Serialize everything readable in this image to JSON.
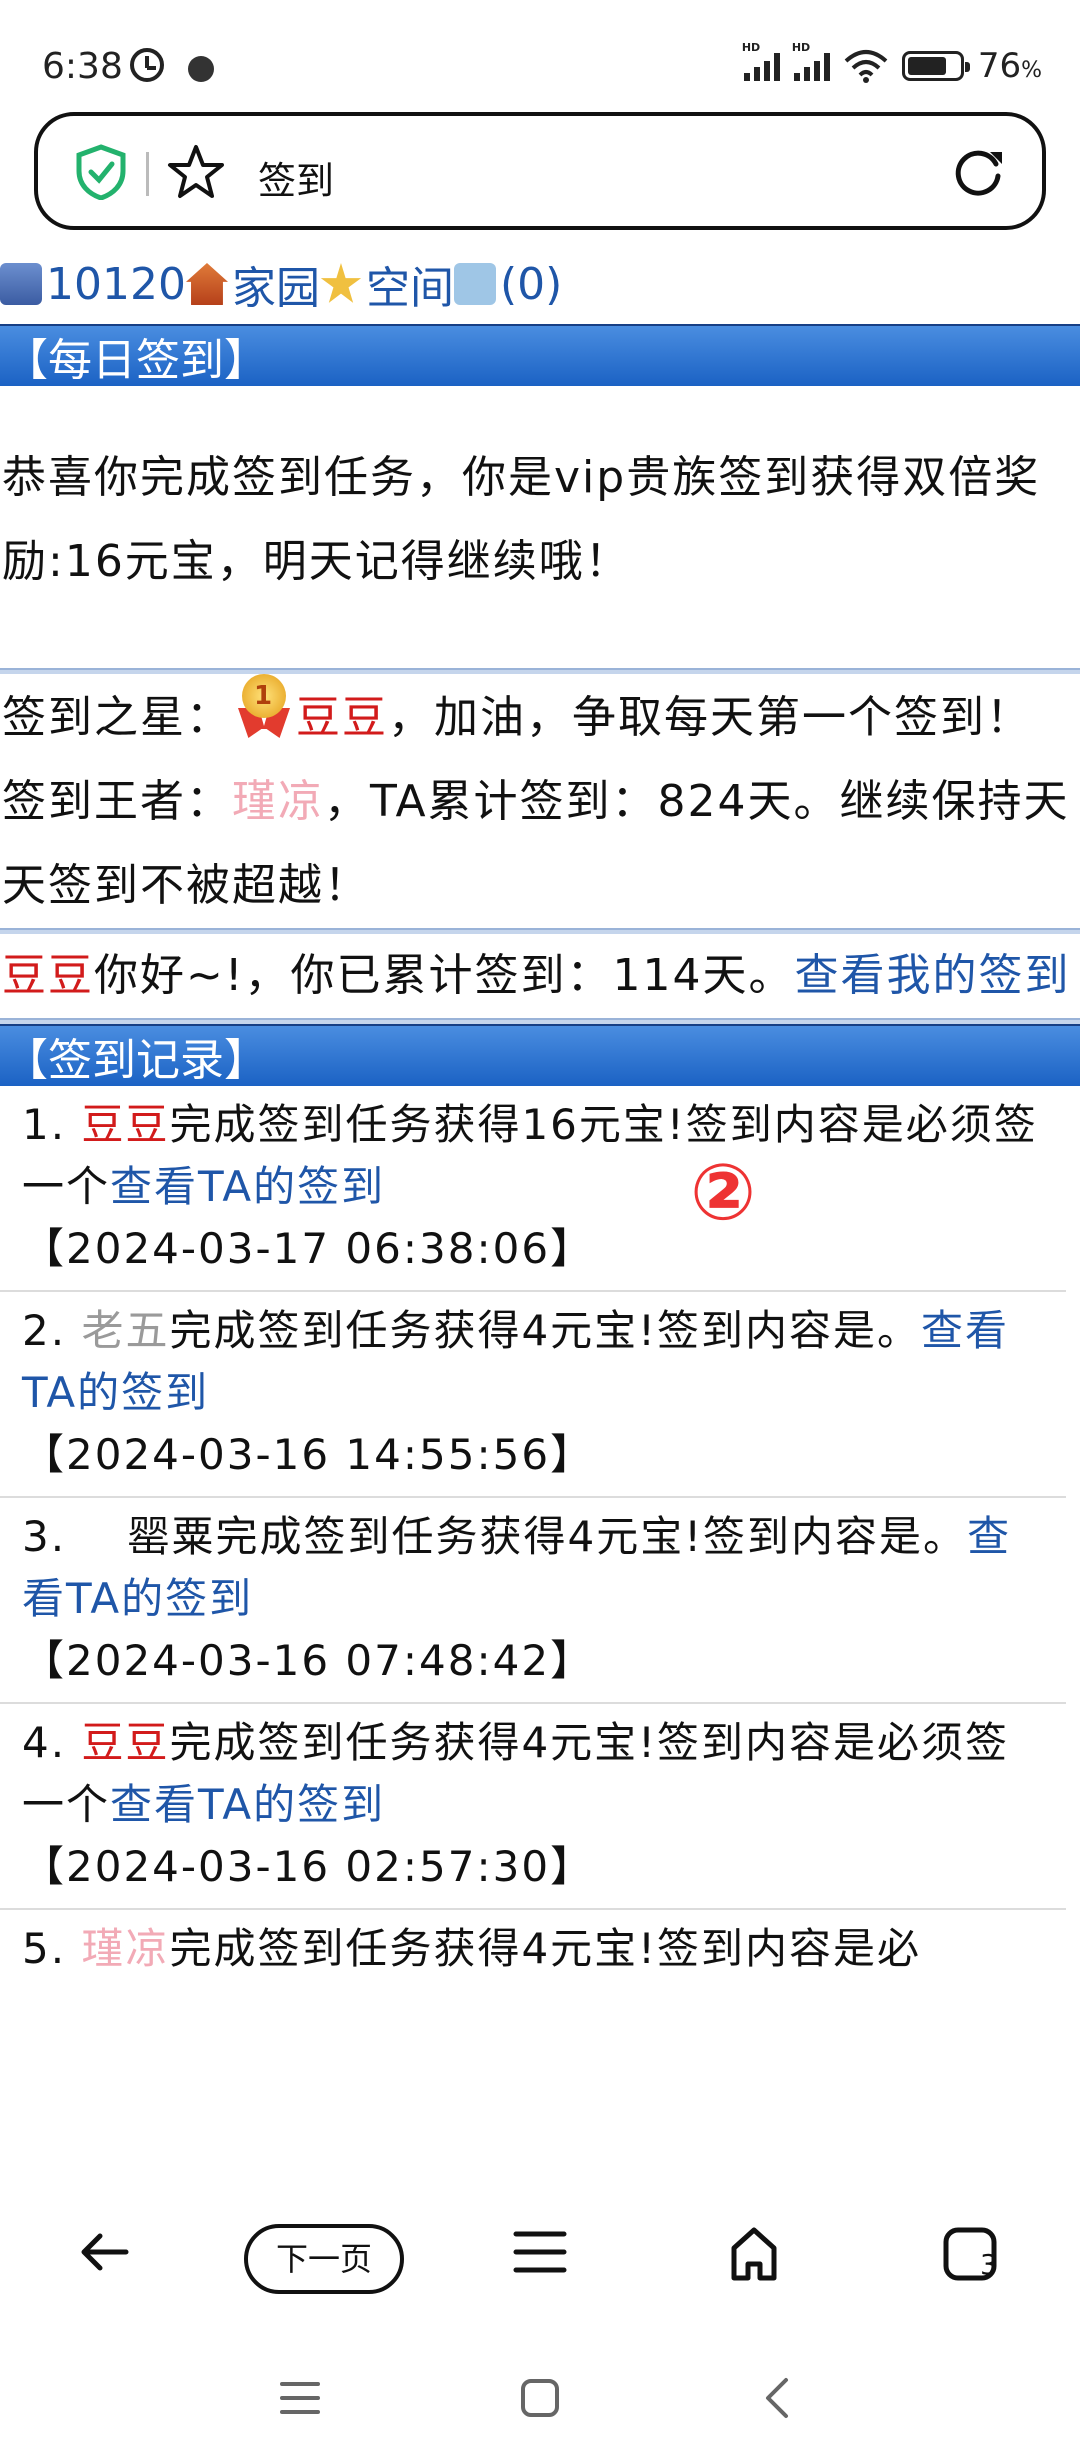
{
  "status": {
    "time": "6:38",
    "battery_pct": "76",
    "battery_unit": "%",
    "battery_level": 0.76,
    "hd": "HD"
  },
  "address_bar": {
    "text": "签到"
  },
  "topnav": {
    "uid": "10120",
    "home": "家园",
    "space": "空间",
    "messages": "(0)"
  },
  "daily": {
    "header": "【每日签到】",
    "message": "恭喜你完成签到任务，你是vip贵族签到获得双倍奖励:16元宝，明天记得继续哦！"
  },
  "star": {
    "prefix": "签到之星：",
    "medal_number": "1",
    "name": "豆豆",
    "suffix": "，加油，争取每天第一个签到！"
  },
  "king": {
    "prefix": "签到王者：",
    "name": "瑾凉",
    "suffix": "，TA累计签到：824天。继续保持天天签到不被超越！"
  },
  "me": {
    "name": "豆豆",
    "text": "你好~!，你已累计签到：114天。",
    "link": "查看我的签到"
  },
  "records": {
    "header": "【签到记录】",
    "items": [
      {
        "index": "1.",
        "user": "豆豆",
        "user_color": "red",
        "text": "完成签到任务获得16元宝!签到内容是必须签一个",
        "link": "查看TA的签到",
        "time": "【2024-03-17 06:38:06】"
      },
      {
        "index": "2.",
        "user": "老五",
        "user_color": "gray",
        "text": "完成签到任务获得4元宝!签到内容是。",
        "link": "查看TA的签到",
        "time": "【2024-03-16 14:55:56】"
      },
      {
        "index": "3.",
        "user": "罂粟",
        "user_color": "black",
        "text": "完成签到任务获得4元宝!签到内容是。",
        "link": "查看TA的签到",
        "time": "【2024-03-16 07:48:42】"
      },
      {
        "index": "4.",
        "user": "豆豆",
        "user_color": "red",
        "text": "完成签到任务获得4元宝!签到内容是必须签一个",
        "link": "查看TA的签到",
        "time": "【2024-03-16 02:57:30】"
      },
      {
        "index": "5.",
        "user": "瑾凉",
        "user_color": "pink",
        "text": "完成签到任务获得4元宝!签到内容是必",
        "link": "",
        "time": ""
      }
    ]
  },
  "annotation": {
    "mark": "②",
    "color": "#e33333"
  },
  "bottom_nav": {
    "next_label": "下一页"
  },
  "colors": {
    "link": "#1f56a8",
    "header_bg": "#1b62c4",
    "red_name": "#d21b1b",
    "pink_name": "#f2aab6"
  }
}
